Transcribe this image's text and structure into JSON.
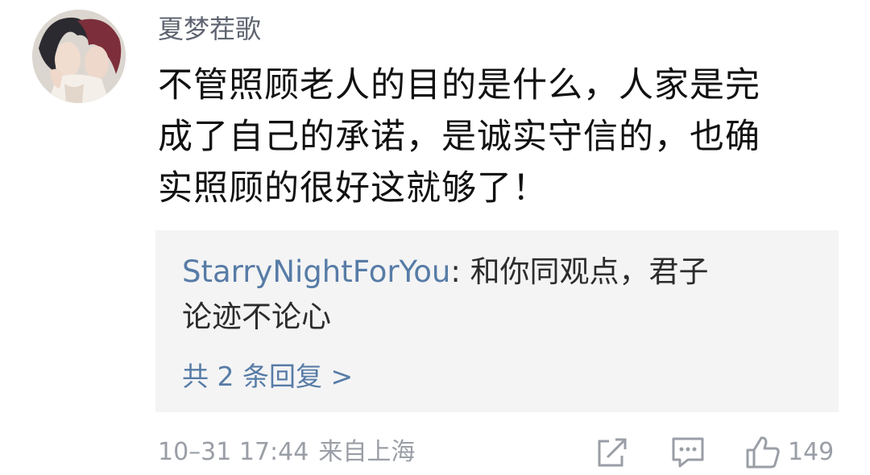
{
  "comment": {
    "username": "夏梦茬歌",
    "text_lines": [
      "不管照顾老人的目的是什么，人家是完",
      "成了自己的承诺，是诚实守信的，也确",
      "实照顾的很好这就够了！"
    ]
  },
  "reply": {
    "username": "StarryNightForYou",
    "separator": ": ",
    "text_line1": "和你同观点，君子",
    "text_line2": "论迹不论心",
    "count_label": "共 2 条回复 >"
  },
  "meta": {
    "datetime": "10–31 17:44",
    "location": "来自上海"
  },
  "actions": {
    "share_icon": "share-icon",
    "comment_icon": "comment-icon",
    "like_icon": "thumbs-up-icon",
    "like_count": "149"
  },
  "colors": {
    "link": "#577ca6",
    "meta": "#9a9ea6",
    "reply_bg": "#f4f4f5"
  }
}
